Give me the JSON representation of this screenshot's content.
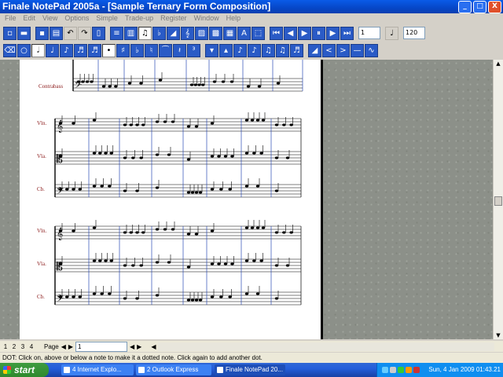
{
  "window": {
    "title": "Finale NotePad 2005a - [Sample Ternary Form Composition]",
    "minimize": "_",
    "maximize": "□",
    "close": "X"
  },
  "menu": [
    "File",
    "Edit",
    "View",
    "Options",
    "Simple",
    "Trade-up",
    "Register",
    "Window",
    "Help"
  ],
  "toolbar": {
    "measure_field": "1",
    "tempo_field": "120",
    "tempo_note": "♩"
  },
  "score": {
    "top_label": "Contrabass",
    "system2": [
      "Vln.",
      "Vla.",
      "Cb."
    ],
    "system3": [
      "Vln.",
      "Vla.",
      "Cb."
    ]
  },
  "pagebar": {
    "pages": [
      "1",
      "2",
      "3",
      "4"
    ],
    "label": "Page",
    "value": "1"
  },
  "status": "DOT: Click on, above or below a note to make it a dotted note. Click again to add another dot.",
  "taskbar": {
    "start": "start",
    "tasks": [
      "4 Internet Explo...",
      "2 Outlook Express",
      "Finale NotePad 20..."
    ],
    "clock": "Sun, 4 Jan 2009 01:43.21"
  }
}
